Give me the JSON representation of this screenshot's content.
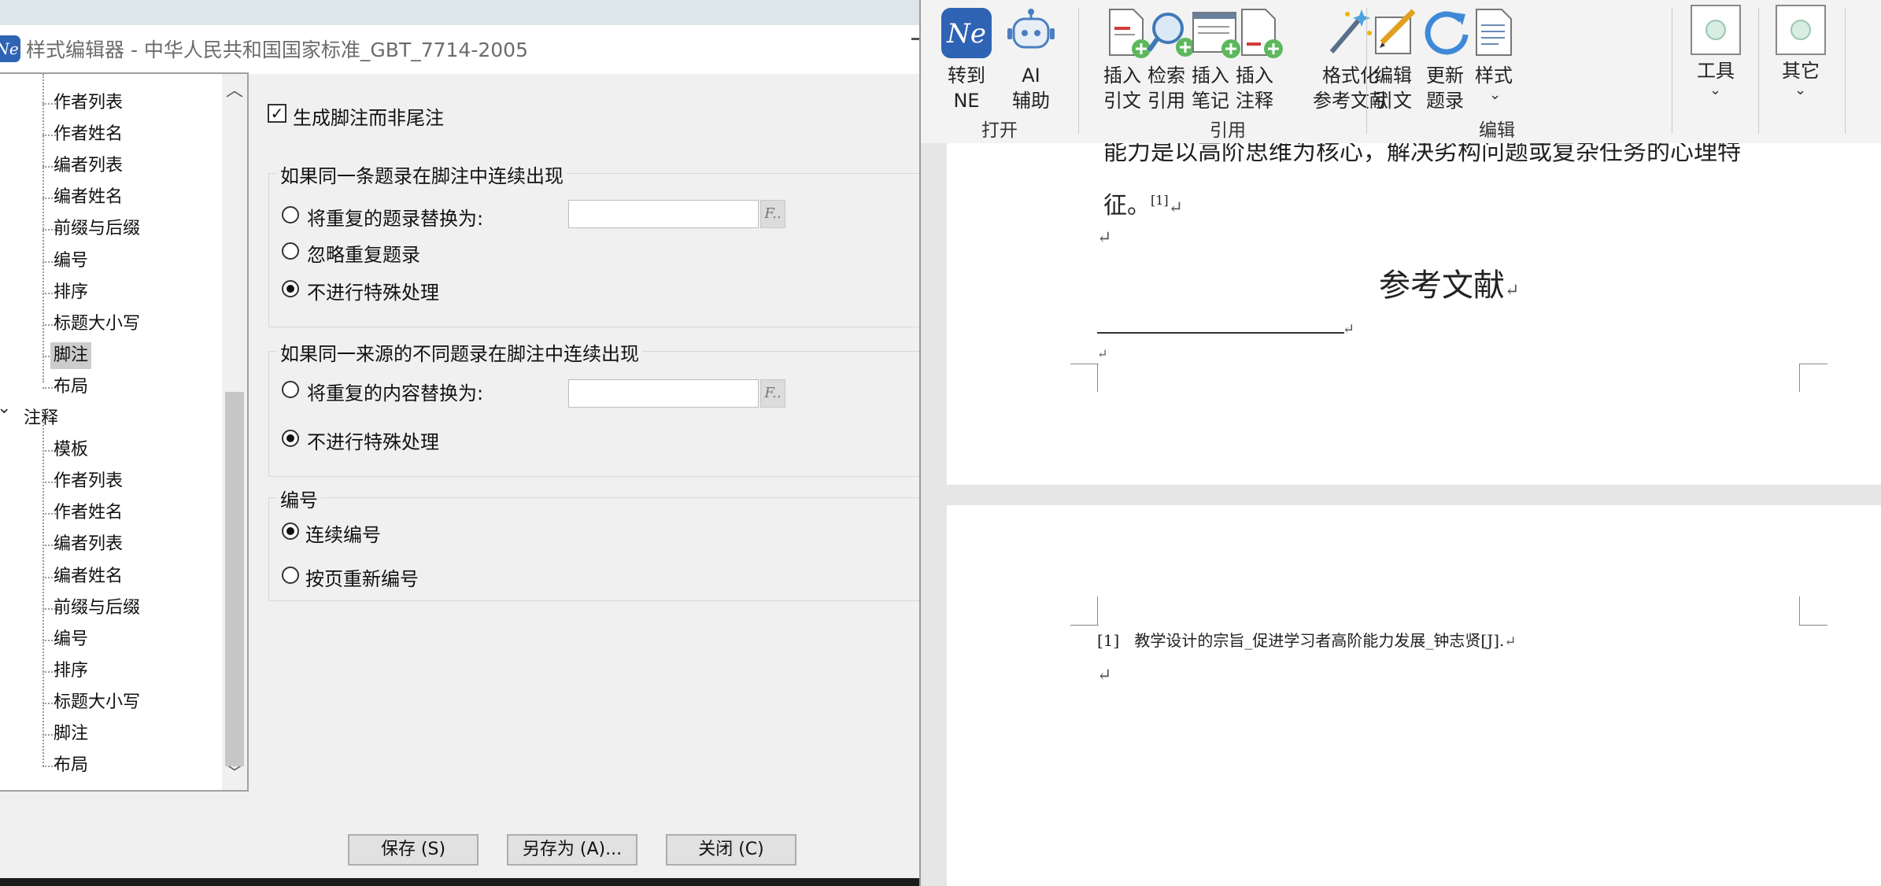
{
  "dialog": {
    "title": "样式编辑器 - 中华人民共和国国家标准_GBT_7714-2005",
    "app_icon": "Ne",
    "tree": {
      "items": [
        {
          "label": "作者列表",
          "level": 2
        },
        {
          "label": "作者姓名",
          "level": 2
        },
        {
          "label": "编者列表",
          "level": 2
        },
        {
          "label": "编者姓名",
          "level": 2
        },
        {
          "label": "前缀与后缀",
          "level": 2
        },
        {
          "label": "编号",
          "level": 2
        },
        {
          "label": "排序",
          "level": 2
        },
        {
          "label": "标题大小写",
          "level": 2
        },
        {
          "label": "脚注",
          "level": 2,
          "selected": true
        },
        {
          "label": "布局",
          "level": 2
        },
        {
          "label": "注释",
          "level": 1,
          "expanded": true
        },
        {
          "label": "模板",
          "level": 2
        },
        {
          "label": "作者列表",
          "level": 2
        },
        {
          "label": "作者姓名",
          "level": 2
        },
        {
          "label": "编者列表",
          "level": 2
        },
        {
          "label": "编者姓名",
          "level": 2
        },
        {
          "label": "前缀与后缀",
          "level": 2
        },
        {
          "label": "编号",
          "level": 2
        },
        {
          "label": "排序",
          "level": 2
        },
        {
          "label": "标题大小写",
          "level": 2
        },
        {
          "label": "脚注",
          "level": 2
        },
        {
          "label": "布局",
          "level": 2
        }
      ]
    },
    "footnote_checkbox": {
      "label": "生成脚注而非尾注",
      "checked": true
    },
    "group1": {
      "title": "如果同一条题录在脚注中连续出现",
      "opt1": "将重复的题录替换为:",
      "opt2": "忽略重复题录",
      "opt3": "不进行特殊处理",
      "selected": 3,
      "input_value": "",
      "f_button": "F.."
    },
    "group2": {
      "title": "如果同一来源的不同题录在脚注中连续出现",
      "opt1": "将重复的内容替换为:",
      "opt2": "不进行特殊处理",
      "selected": 2,
      "input_value": "",
      "f_button": "F.."
    },
    "group3": {
      "title": "编号",
      "opt1": "连续编号",
      "opt2": "按页重新编号",
      "selected": 1
    },
    "buttons": {
      "save": "保存 (S)",
      "save_as": "另存为 (A)...",
      "close": "关闭 (C)"
    }
  },
  "ribbon": {
    "buttons": [
      {
        "line1": "转到",
        "line2": "NE",
        "icon": "ne-logo-icon"
      },
      {
        "line1": "AI",
        "line2": "辅助",
        "icon": "robot-icon"
      },
      {
        "line1": "插入",
        "line2": "引文",
        "icon": "insert-citation-icon"
      },
      {
        "line1": "检索",
        "line2": "引用",
        "icon": "search-citation-icon"
      },
      {
        "line1": "插入",
        "line2": "笔记",
        "icon": "insert-note-icon"
      },
      {
        "line1": "插入",
        "line2": "注释",
        "icon": "insert-annotation-icon"
      },
      {
        "line1": "格式化",
        "line2": "参考文献",
        "icon": "magic-wand-icon"
      },
      {
        "line1": "编辑",
        "line2": "引文",
        "icon": "edit-citation-icon"
      },
      {
        "line1": "更新",
        "line2": "题录",
        "icon": "refresh-icon"
      },
      {
        "line1": "样式",
        "line2": "",
        "icon": "style-icon"
      },
      {
        "line1": "工具",
        "line2": "",
        "icon": "tools-icon"
      },
      {
        "line1": "其它",
        "line2": "",
        "icon": "other-icon"
      }
    ],
    "groups": {
      "open": "打开",
      "cite": "引用",
      "edit": "编辑"
    }
  },
  "document": {
    "line1": "能力是以高阶思维为核心，解决劣构问题或复杂任务的心理特",
    "line2": "征。",
    "citation_mark": "[1]",
    "heading": "参考文献",
    "footnote_ref": "[1]",
    "footnote_text": "教学设计的宗旨_促进学习者高阶能力发展_钟志贤[J].",
    "para_mark": "↵"
  },
  "colors": {
    "ne_blue": "#2f63b3",
    "selected_tree": "#cccccc",
    "ribbon_bg": "#f3f3f3"
  }
}
